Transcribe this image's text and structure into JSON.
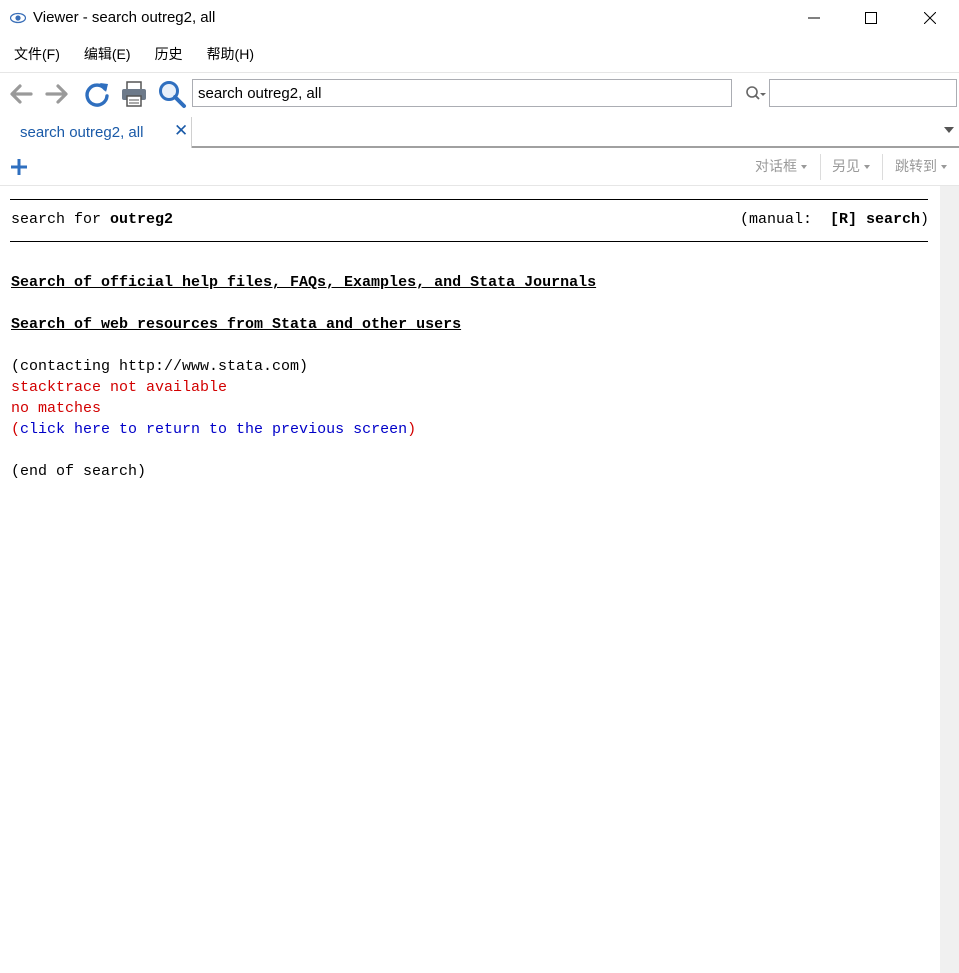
{
  "window": {
    "title": "Viewer - search outreg2, all"
  },
  "menu": [
    "文件(F)",
    "编辑(E)",
    "历史",
    "帮助(H)"
  ],
  "toolbar": {
    "search_value": "search outreg2, all",
    "find_value": ""
  },
  "tabs": [
    {
      "label": "search outreg2, all",
      "close": "✕"
    }
  ],
  "subbar": {
    "dialog_label": "对话框",
    "also_see_label": "另见",
    "jump_to_label": "跳转到"
  },
  "content": {
    "header_prefix": "search for ",
    "header_term": "outreg2",
    "manual_prefix": "(manual:  ",
    "manual_ref": "[R] search",
    "manual_suffix": ")",
    "section_official": "Search of official help files, FAQs, Examples, and Stata Journals",
    "section_web": "Search of web resources from Stata and other users",
    "contacting": "(contacting http://www.stata.com)",
    "error_stacktrace": "stacktrace not available",
    "no_matches": "no matches",
    "paren_open": "(",
    "return_link": "click here to return to the previous screen",
    "paren_close": ")",
    "end": "(end of search)"
  },
  "colors": {
    "accent_blue": "#1a5aa8",
    "error_red": "#d20000",
    "link_blue": "#0000c8"
  },
  "icons": [
    "eye-icon",
    "back-arrow-icon",
    "forward-arrow-icon",
    "refresh-icon",
    "print-icon",
    "search-icon",
    "find-icon",
    "plus-icon"
  ]
}
